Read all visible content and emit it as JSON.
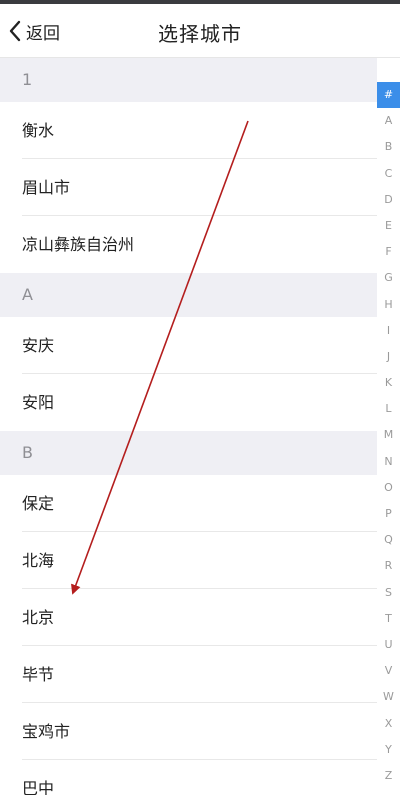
{
  "nav": {
    "back_label": "返回",
    "title": "选择城市"
  },
  "sections": [
    {
      "header": "1",
      "cities": [
        "衡水",
        "眉山市",
        "凉山彝族自治州"
      ]
    },
    {
      "header": "A",
      "cities": [
        "安庆",
        "安阳"
      ]
    },
    {
      "header": "B",
      "cities": [
        "保定",
        "北海",
        "北京",
        "毕节",
        "宝鸡市",
        "巴中"
      ]
    }
  ],
  "index_bar": {
    "letters": [
      "#",
      "A",
      "B",
      "C",
      "D",
      "E",
      "F",
      "G",
      "H",
      "I",
      "J",
      "K",
      "L",
      "M",
      "N",
      "O",
      "P",
      "Q",
      "R",
      "S",
      "T",
      "U",
      "V",
      "W",
      "X",
      "Y",
      "Z"
    ],
    "active": "#",
    "active_color": "#3b8ee9"
  },
  "annotation": {
    "arrow_color": "#b41e1e"
  }
}
